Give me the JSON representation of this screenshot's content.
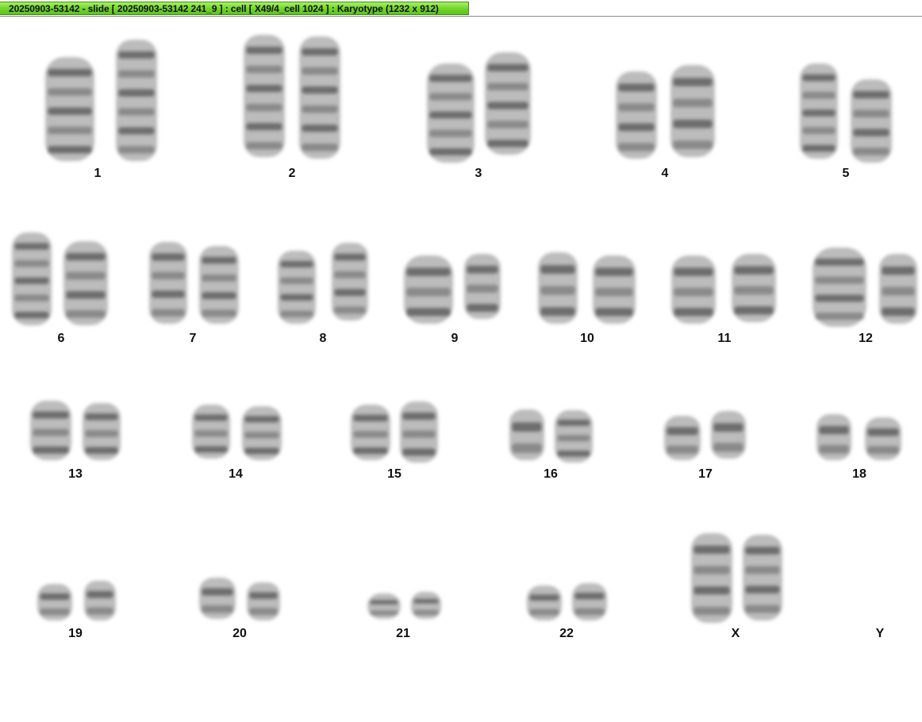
{
  "window": {
    "title": "20250903-53142 - slide [ 20250903-53142 241_9 ] : cell [ X49/4_cell 1024 ] : Karyotype  (1232 x 912)"
  },
  "colors": {
    "titlebar_green": "#6fd428",
    "chromosome": "#5a5a5a",
    "background": "#ffffff"
  },
  "karyotype": {
    "labels": [
      "1",
      "2",
      "3",
      "4",
      "5",
      "6",
      "7",
      "8",
      "9",
      "10",
      "11",
      "12",
      "13",
      "14",
      "15",
      "16",
      "17",
      "18",
      "19",
      "20",
      "21",
      "22",
      "X",
      "Y"
    ]
  }
}
